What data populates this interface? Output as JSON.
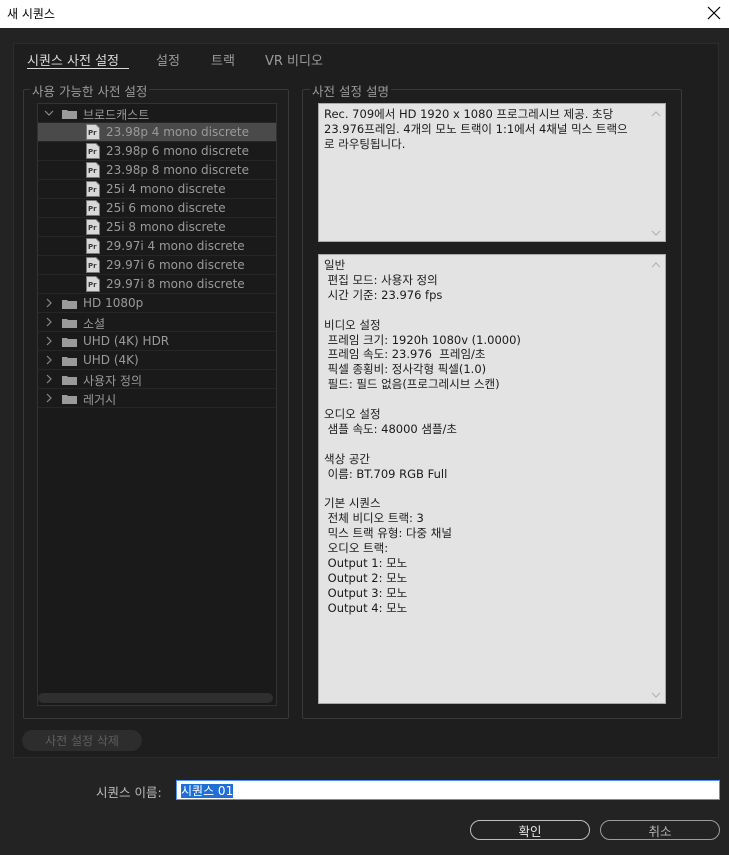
{
  "window": {
    "title": "새 시퀀스"
  },
  "tabs": [
    {
      "label": "시퀀스 사전 설정",
      "active": true
    },
    {
      "label": "설정",
      "active": false
    },
    {
      "label": "트랙",
      "active": false
    },
    {
      "label": "VR 비디오",
      "active": false
    }
  ],
  "presets": {
    "group_label": "사용 가능한 사전 설정",
    "tree": [
      {
        "type": "folder",
        "label": "브로드캐스트",
        "expanded": true
      },
      {
        "type": "file",
        "label": "23.98p 4 mono discrete",
        "selected": true
      },
      {
        "type": "file",
        "label": "23.98p 6 mono discrete"
      },
      {
        "type": "file",
        "label": "23.98p 8 mono discrete"
      },
      {
        "type": "file",
        "label": "25i 4 mono discrete"
      },
      {
        "type": "file",
        "label": "25i 6 mono discrete"
      },
      {
        "type": "file",
        "label": "25i 8 mono discrete"
      },
      {
        "type": "file",
        "label": "29.97i 4 mono discrete"
      },
      {
        "type": "file",
        "label": "29.97i 6 mono discrete"
      },
      {
        "type": "file",
        "label": "29.97i 8 mono discrete"
      },
      {
        "type": "folder",
        "label": "HD 1080p",
        "expanded": false
      },
      {
        "type": "folder",
        "label": "소셜",
        "expanded": false
      },
      {
        "type": "folder",
        "label": "UHD (4K) HDR",
        "expanded": false
      },
      {
        "type": "folder",
        "label": "UHD (4K)",
        "expanded": false
      },
      {
        "type": "folder",
        "label": "사용자 정의",
        "expanded": false
      },
      {
        "type": "folder",
        "label": "레거시",
        "expanded": false
      }
    ],
    "delete_button": "사전 설정 삭제"
  },
  "description": {
    "group_label": "사전 설정 설명",
    "summary_lines": [
      "Rec. 709에서 HD 1920 x 1080 프로그레시브 제공. 초당",
      "23.976프레임. 4개의 모노 트랙이 1:1에서 4채널 믹스 트랙으",
      "로 라우팅됩니다."
    ],
    "details_lines": [
      "일반",
      " 편집 모드: 사용자 정의",
      " 시간 기준: 23.976 fps",
      "",
      "비디오 설정",
      " 프레임 크기: 1920h 1080v (1.0000)",
      " 프레임 속도: 23.976  프레임/초",
      " 픽셀 종횡비: 정사각형 픽셀(1.0)",
      " 필드: 필드 없음(프로그레시브 스캔)",
      "",
      "오디오 설정",
      " 샘플 속도: 48000 샘플/초",
      "",
      "색상 공간",
      " 이름: BT.709 RGB Full",
      "",
      "기본 시퀀스",
      " 전체 비디오 트랙: 3",
      " 믹스 트랙 유형: 다중 채널",
      " 오디오 트랙:",
      " Output 1: 모노",
      " Output 2: 모노",
      " Output 3: 모노",
      " Output 4: 모노"
    ]
  },
  "footer": {
    "name_label": "시퀀스 이름:",
    "name_value": "시퀀스 01",
    "ok_label": "확인",
    "cancel_label": "취소"
  },
  "colors": {
    "background": "#232323",
    "selection_bg": "#4a4a4a",
    "input_highlight": "#1f6fd6",
    "pane_bg": "#e3e3e3"
  },
  "icons": {
    "close": "close-icon",
    "folder": "folder-icon",
    "preset_file": "premiere-preset-icon",
    "expand": "chevron-right-icon",
    "collapse": "chevron-down-icon"
  }
}
